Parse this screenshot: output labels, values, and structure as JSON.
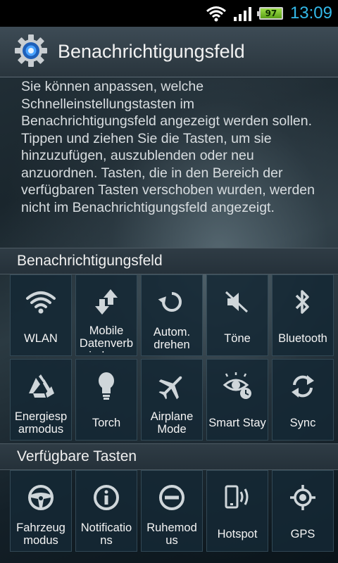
{
  "status_bar": {
    "battery_level": "97",
    "time": "13:09",
    "icons": [
      "wifi-icon",
      "signal-icon",
      "battery-icon"
    ]
  },
  "header": {
    "title": "Benachrichtigungsfeld",
    "icon": "gear-icon"
  },
  "description": "Sie können anpassen, welche Schnelleinstellungstasten im Benachrichtigungsfeld angezeigt werden sollen. Tippen und ziehen Sie die Tasten, um sie hinzuzufügen, auszublenden oder neu anzuordnen. Tasten, die in den Bereich der verfügbaren Tasten verschoben wurden, werden nicht im Benachrichtigungsfeld angezeigt.",
  "sections": {
    "active": {
      "title": "Benachrichtigungsfeld",
      "tiles": [
        {
          "label": "WLAN",
          "icon": "wifi-icon"
        },
        {
          "label": "Mobile Datenverb indung",
          "icon": "mobile-data-icon"
        },
        {
          "label": "Autom. drehen",
          "icon": "rotate-icon"
        },
        {
          "label": "Töne",
          "icon": "sound-muted-icon"
        },
        {
          "label": "Bluetooth",
          "icon": "bluetooth-icon"
        },
        {
          "label": "Energiesp armodus",
          "icon": "recycle-icon"
        },
        {
          "label": "Torch",
          "icon": "torch-icon"
        },
        {
          "label": "Airplane Mode",
          "icon": "airplane-icon"
        },
        {
          "label": "Smart Stay",
          "icon": "smart-stay-icon"
        },
        {
          "label": "Sync",
          "icon": "sync-icon"
        }
      ]
    },
    "available": {
      "title": "Verfügbare Tasten",
      "tiles": [
        {
          "label": "Fahrzeug modus",
          "icon": "steering-wheel-icon"
        },
        {
          "label": "Notificatio ns",
          "icon": "info-icon"
        },
        {
          "label": "Ruhemod us",
          "icon": "do-not-disturb-icon"
        },
        {
          "label": "Hotspot",
          "icon": "hotspot-icon"
        },
        {
          "label": "GPS",
          "icon": "gps-icon"
        }
      ]
    }
  },
  "colors": {
    "clock": "#33b8e8",
    "tile_bg": "#142834",
    "battery": "#7cc12f"
  }
}
